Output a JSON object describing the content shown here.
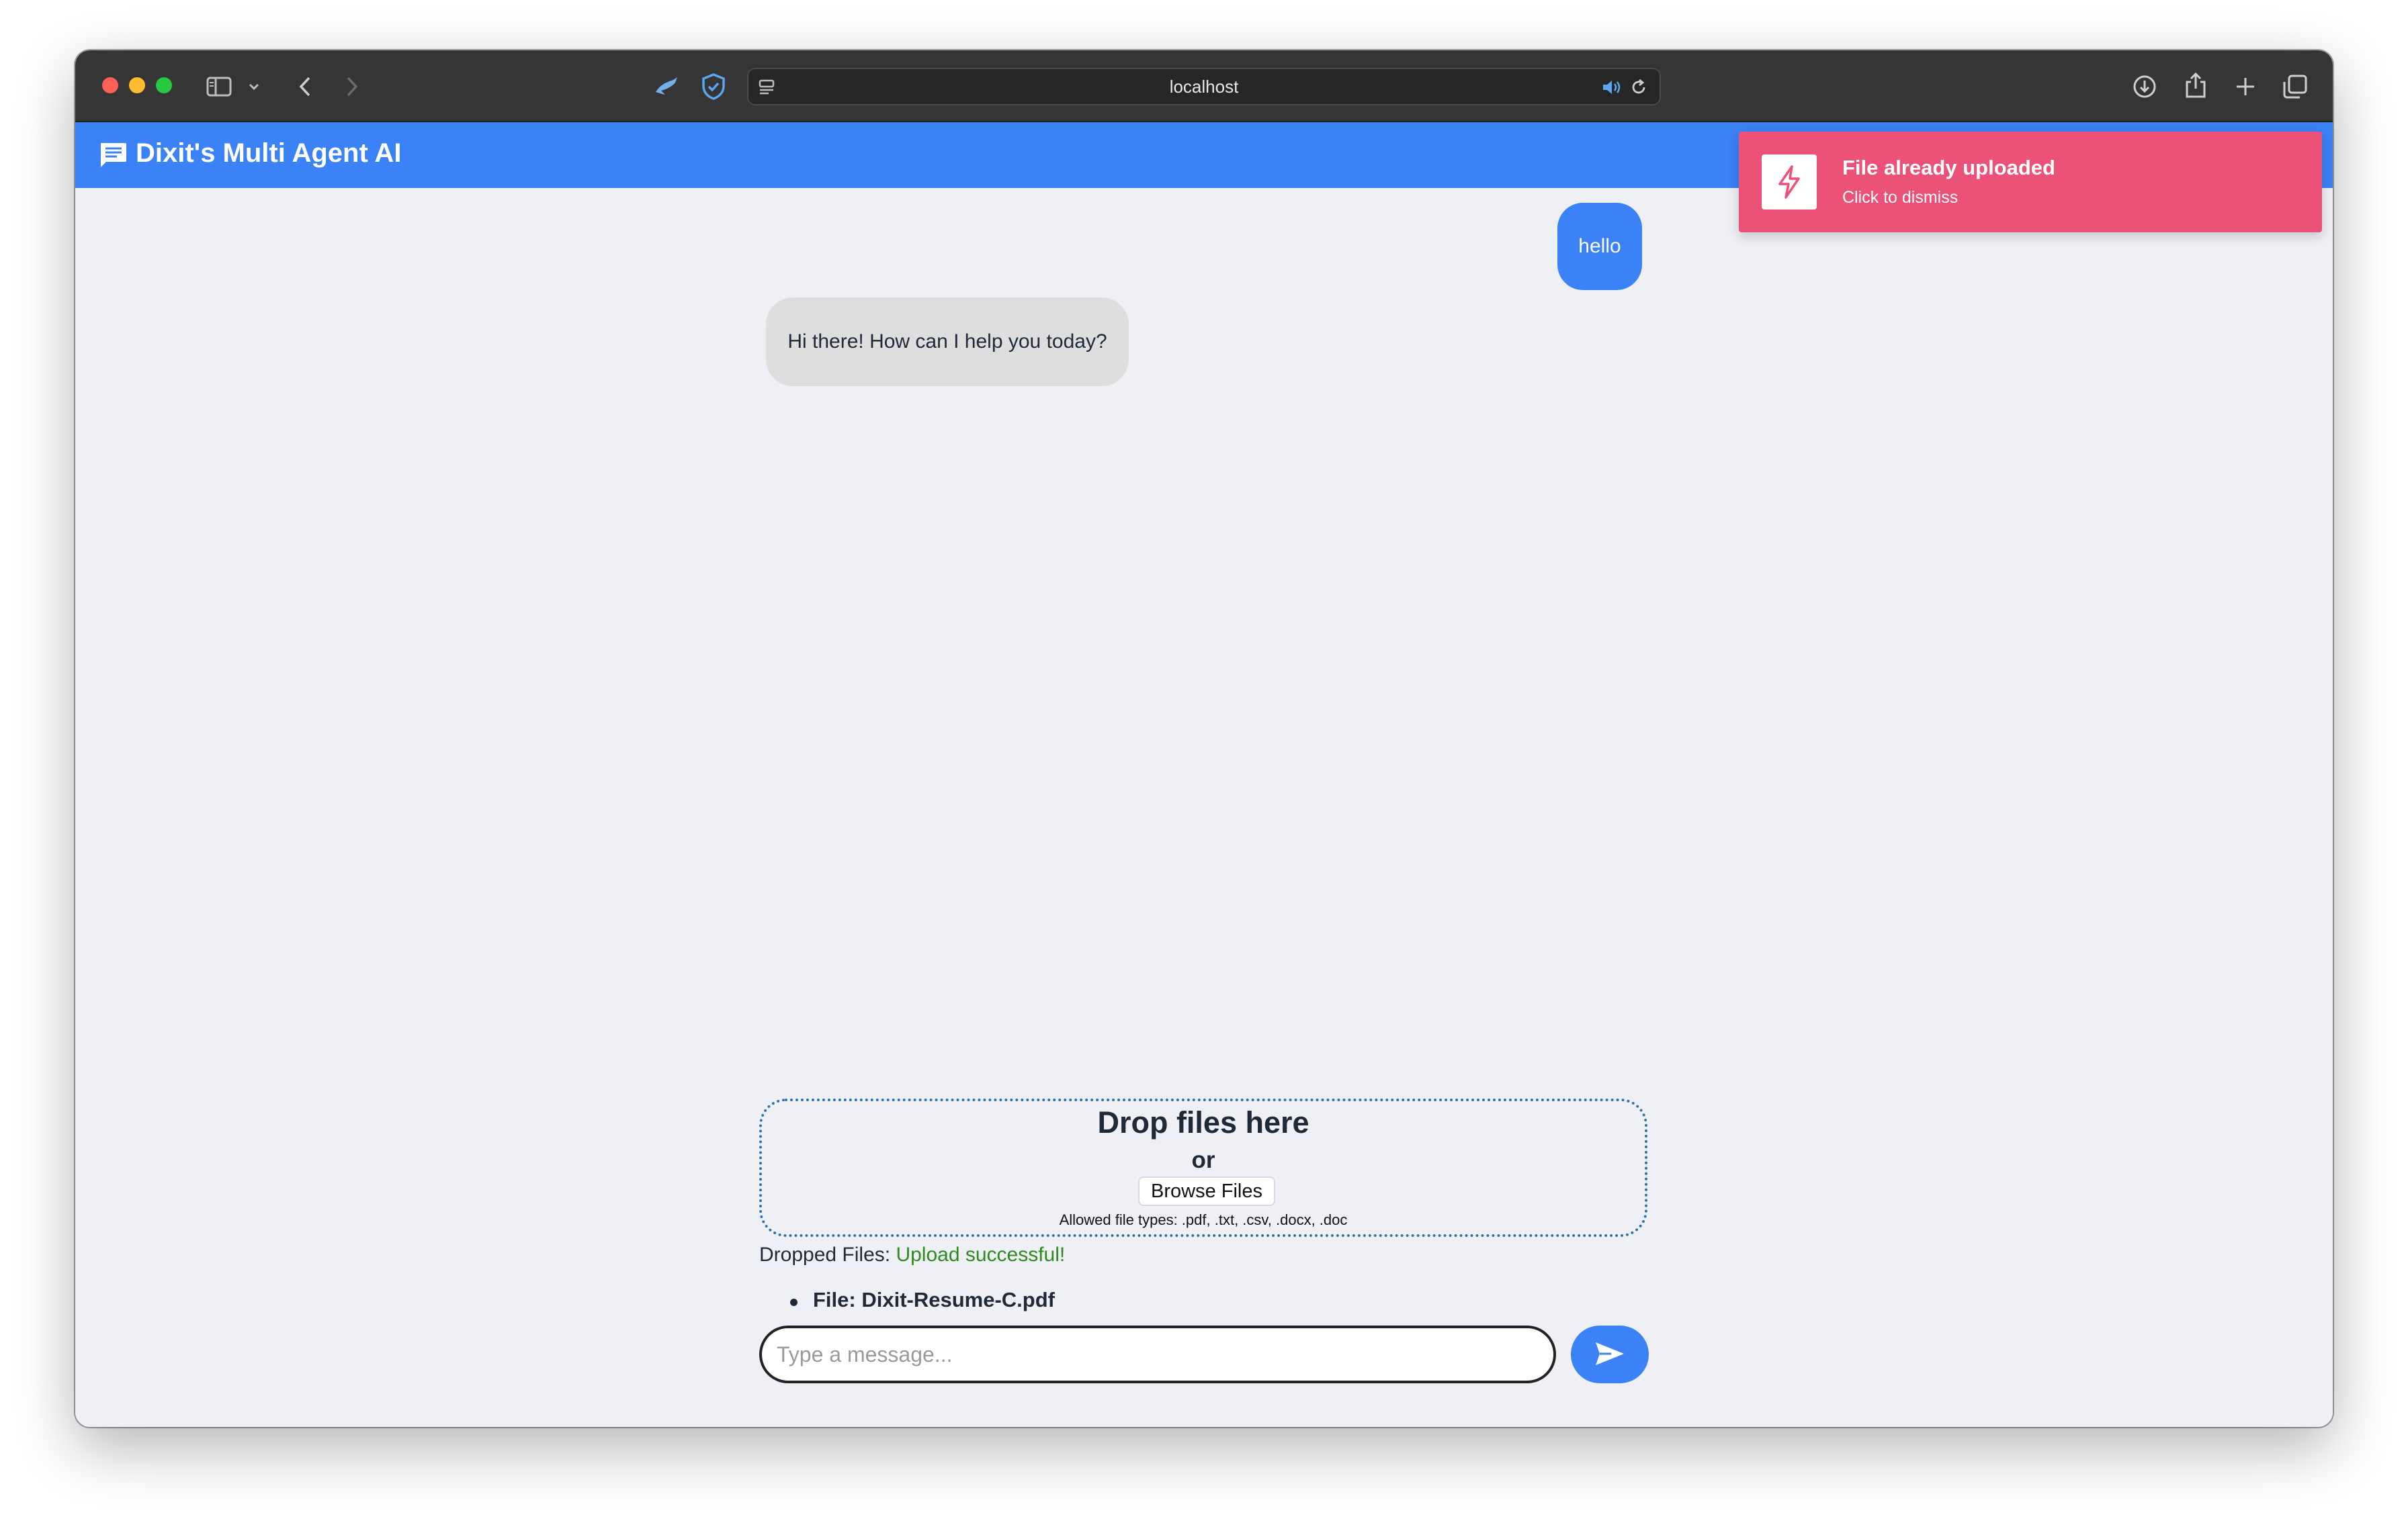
{
  "browser": {
    "url": "localhost",
    "icons": [
      "sidebar-icon",
      "chevron-down-icon",
      "back-icon",
      "forward-icon",
      "bird-extension-icon",
      "shield-check-icon",
      "reader-icon",
      "speaker-icon",
      "reload-icon",
      "download-icon",
      "share-icon",
      "plus-icon",
      "tabs-icon"
    ]
  },
  "app": {
    "title": "Dixit's Multi Agent AI",
    "accent_color": "#3b82f6"
  },
  "toast": {
    "title": "File already uploaded",
    "subtitle": "Click to dismiss",
    "color": "#ec5177"
  },
  "chat": {
    "messages": [
      {
        "role": "user",
        "text": "hello"
      },
      {
        "role": "assistant",
        "text": "Hi there! How can I help you today?"
      }
    ]
  },
  "dropzone": {
    "title": "Drop files here",
    "or_text": "or",
    "browse_label": "Browse Files",
    "allowed_text": "Allowed file types: .pdf, .txt, .csv, .docx, .doc"
  },
  "dropped": {
    "label": "Dropped Files: ",
    "status": "Upload successful!",
    "status_color": "#2f8a1e",
    "files": [
      {
        "label": "File: Dixit-Resume-C.pdf"
      }
    ]
  },
  "composer": {
    "placeholder": "Type a message...",
    "value": ""
  }
}
